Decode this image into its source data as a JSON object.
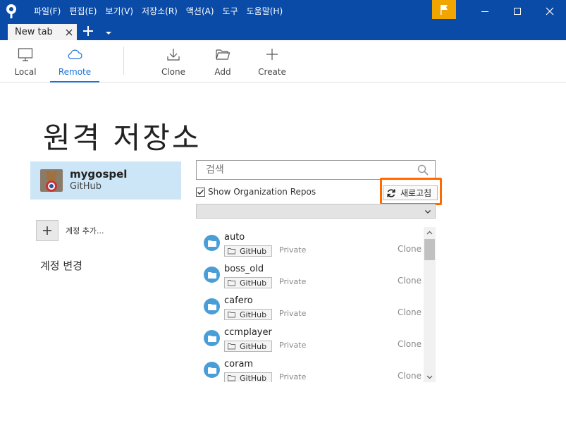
{
  "menu": [
    "파일(F)",
    "편집(E)",
    "보기(V)",
    "저장소(R)",
    "액션(A)",
    "도구",
    "도움말(H)"
  ],
  "tab": {
    "label": "New tab"
  },
  "toolbar": {
    "local": "Local",
    "remote": "Remote",
    "clone": "Clone",
    "add": "Add",
    "create": "Create"
  },
  "page": {
    "title": "원격 저장소"
  },
  "account": {
    "name": "mygospel",
    "host": "GitHub"
  },
  "add_account": {
    "label": "계정 추가..."
  },
  "change_account": {
    "label": "계정 변경"
  },
  "search": {
    "placeholder": "검색"
  },
  "org_filter": {
    "label": "Show Organization Repos",
    "checked": true
  },
  "refresh": {
    "label": "새로고침"
  },
  "repos": [
    {
      "name": "auto",
      "host": "GitHub",
      "visibility": "Private",
      "action": "Clone"
    },
    {
      "name": "boss_old",
      "host": "GitHub",
      "visibility": "Private",
      "action": "Clone"
    },
    {
      "name": "cafero",
      "host": "GitHub",
      "visibility": "Private",
      "action": "Clone"
    },
    {
      "name": "ccmplayer",
      "host": "GitHub",
      "visibility": "Private",
      "action": "Clone"
    },
    {
      "name": "coram",
      "host": "GitHub",
      "visibility": "Private",
      "action": "Clone"
    }
  ],
  "colors": {
    "titlebar": "#0a4ba8",
    "accent": "#1a73d9",
    "highlight": "#ff6a00",
    "flag": "#f0a500",
    "selected_account": "#cde6f7"
  }
}
